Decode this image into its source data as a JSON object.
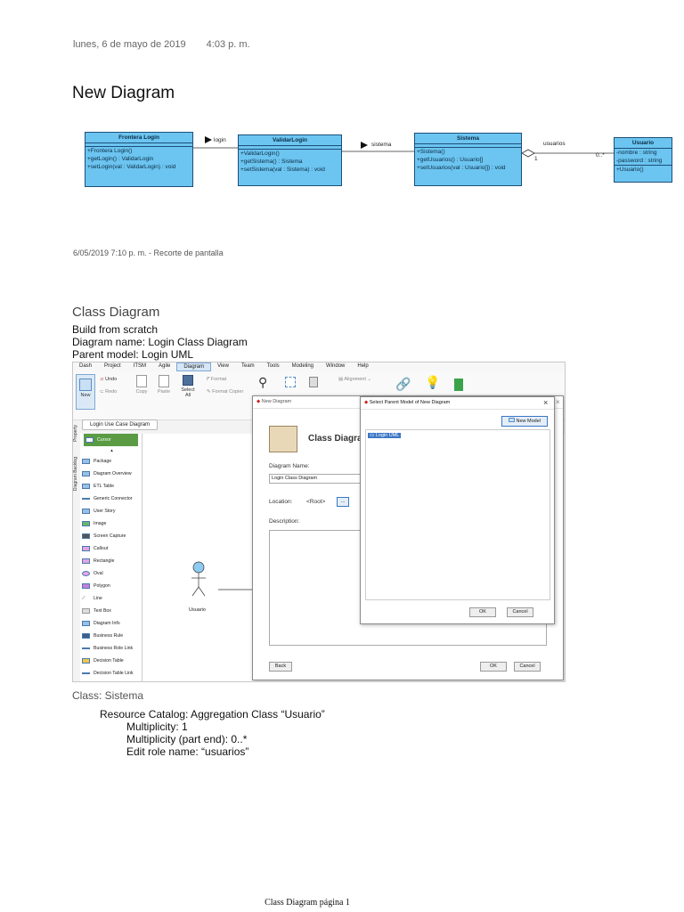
{
  "header": {
    "date": "lunes, 6 de mayo de 2019",
    "time": "4:03 p. m."
  },
  "title": "New Diagram",
  "uml": {
    "classes": [
      {
        "name": "Frontera Login",
        "attributes": [],
        "operations": [
          "+Frontera Login()",
          "+getLogin() : ValidarLogin",
          "+setLogin(val : ValidarLogin) : void"
        ]
      },
      {
        "name": "ValidarLogin",
        "attributes": [],
        "operations": [
          "+ValidarLogin()",
          "+getSistema() : Sistema",
          "+setSistema(val : Sistema) : void"
        ]
      },
      {
        "name": "Sistema",
        "attributes": [],
        "operations": [
          "+Sistema()",
          "+getUsuarios() : Usuario[]",
          "+setUsuarios(val : Usuario[]) : void"
        ]
      },
      {
        "name": "Usuario",
        "attributes": [
          "-nombre : string",
          "-password : string"
        ],
        "operations": [
          "+Usuario()"
        ]
      }
    ],
    "assoc1": "login",
    "assoc2": "sistema",
    "assoc3": "usuarios",
    "mult1": "1",
    "mult2": "0..*"
  },
  "note": "6/05/2019 7:10 p. m. - Recorte de pantalla",
  "section": {
    "heading": "Class Diagram",
    "line1": "Build from scratch",
    "line2": "Diagram name: Login Class Diagram",
    "line3": "Parent model: Login UML"
  },
  "screenshot": {
    "menu": [
      "Dash",
      "Project",
      "ITSM",
      "Agile",
      "Diagram",
      "View",
      "Team",
      "Tools",
      "Modeling",
      "Window",
      "Help"
    ],
    "menu_active": "Diagram",
    "ribbon": {
      "new": "New",
      "undo": "Undo",
      "redo": "Redo",
      "copy": "Copy",
      "paste": "Paste",
      "select_all": "Select All",
      "format": "Format",
      "format_copier": "Format Copier",
      "alignment": "Alignment"
    },
    "tab": "Login Use Case Diagram",
    "vtabs": [
      "Property",
      "Diagram Backlog"
    ],
    "palette": [
      "Cursor",
      "Package",
      "Diagram Overview",
      "ETL Table",
      "Generic Connector",
      "User Story",
      "Image",
      "Screen Capture",
      "Callout",
      "Rectangle",
      "Oval",
      "Polygon",
      "Line",
      "Text Box",
      "Diagram Info",
      "Business Rule",
      "Business Role Link",
      "Decision Table",
      "Decision Table Link"
    ],
    "actor": "Usuario",
    "new_diagram": {
      "title": "New Diagram",
      "heading": "Class Diagram",
      "name_label": "Diagram Name:",
      "name_value": "Login Class Diagram",
      "location_label": "Location:",
      "location_value": "<Root>",
      "browse": "...",
      "description_label": "Description:",
      "back": "Back",
      "ok": "OK",
      "cancel": "Cancel"
    },
    "parent_dialog": {
      "title": "Select Parent Model of New Diagram",
      "new_model": "New Model",
      "item": "Login UML",
      "ok": "OK",
      "cancel": "Cancel",
      "close": "×"
    }
  },
  "class_section": {
    "heading": "Class: Sistema",
    "line": "Resource Catalog: Aggregation Class “Usuario”",
    "sub1": "Multiplicity: 1",
    "sub2": "Multiplicity (part end): 0..*",
    "sub3": "Edit role name: “usuarios”"
  },
  "footer": "Class Diagram página 1",
  "colors": {
    "class_fill": "#6cc5f0",
    "class_border": "#1b4f7a",
    "palette_selected": "#5a9b43"
  }
}
